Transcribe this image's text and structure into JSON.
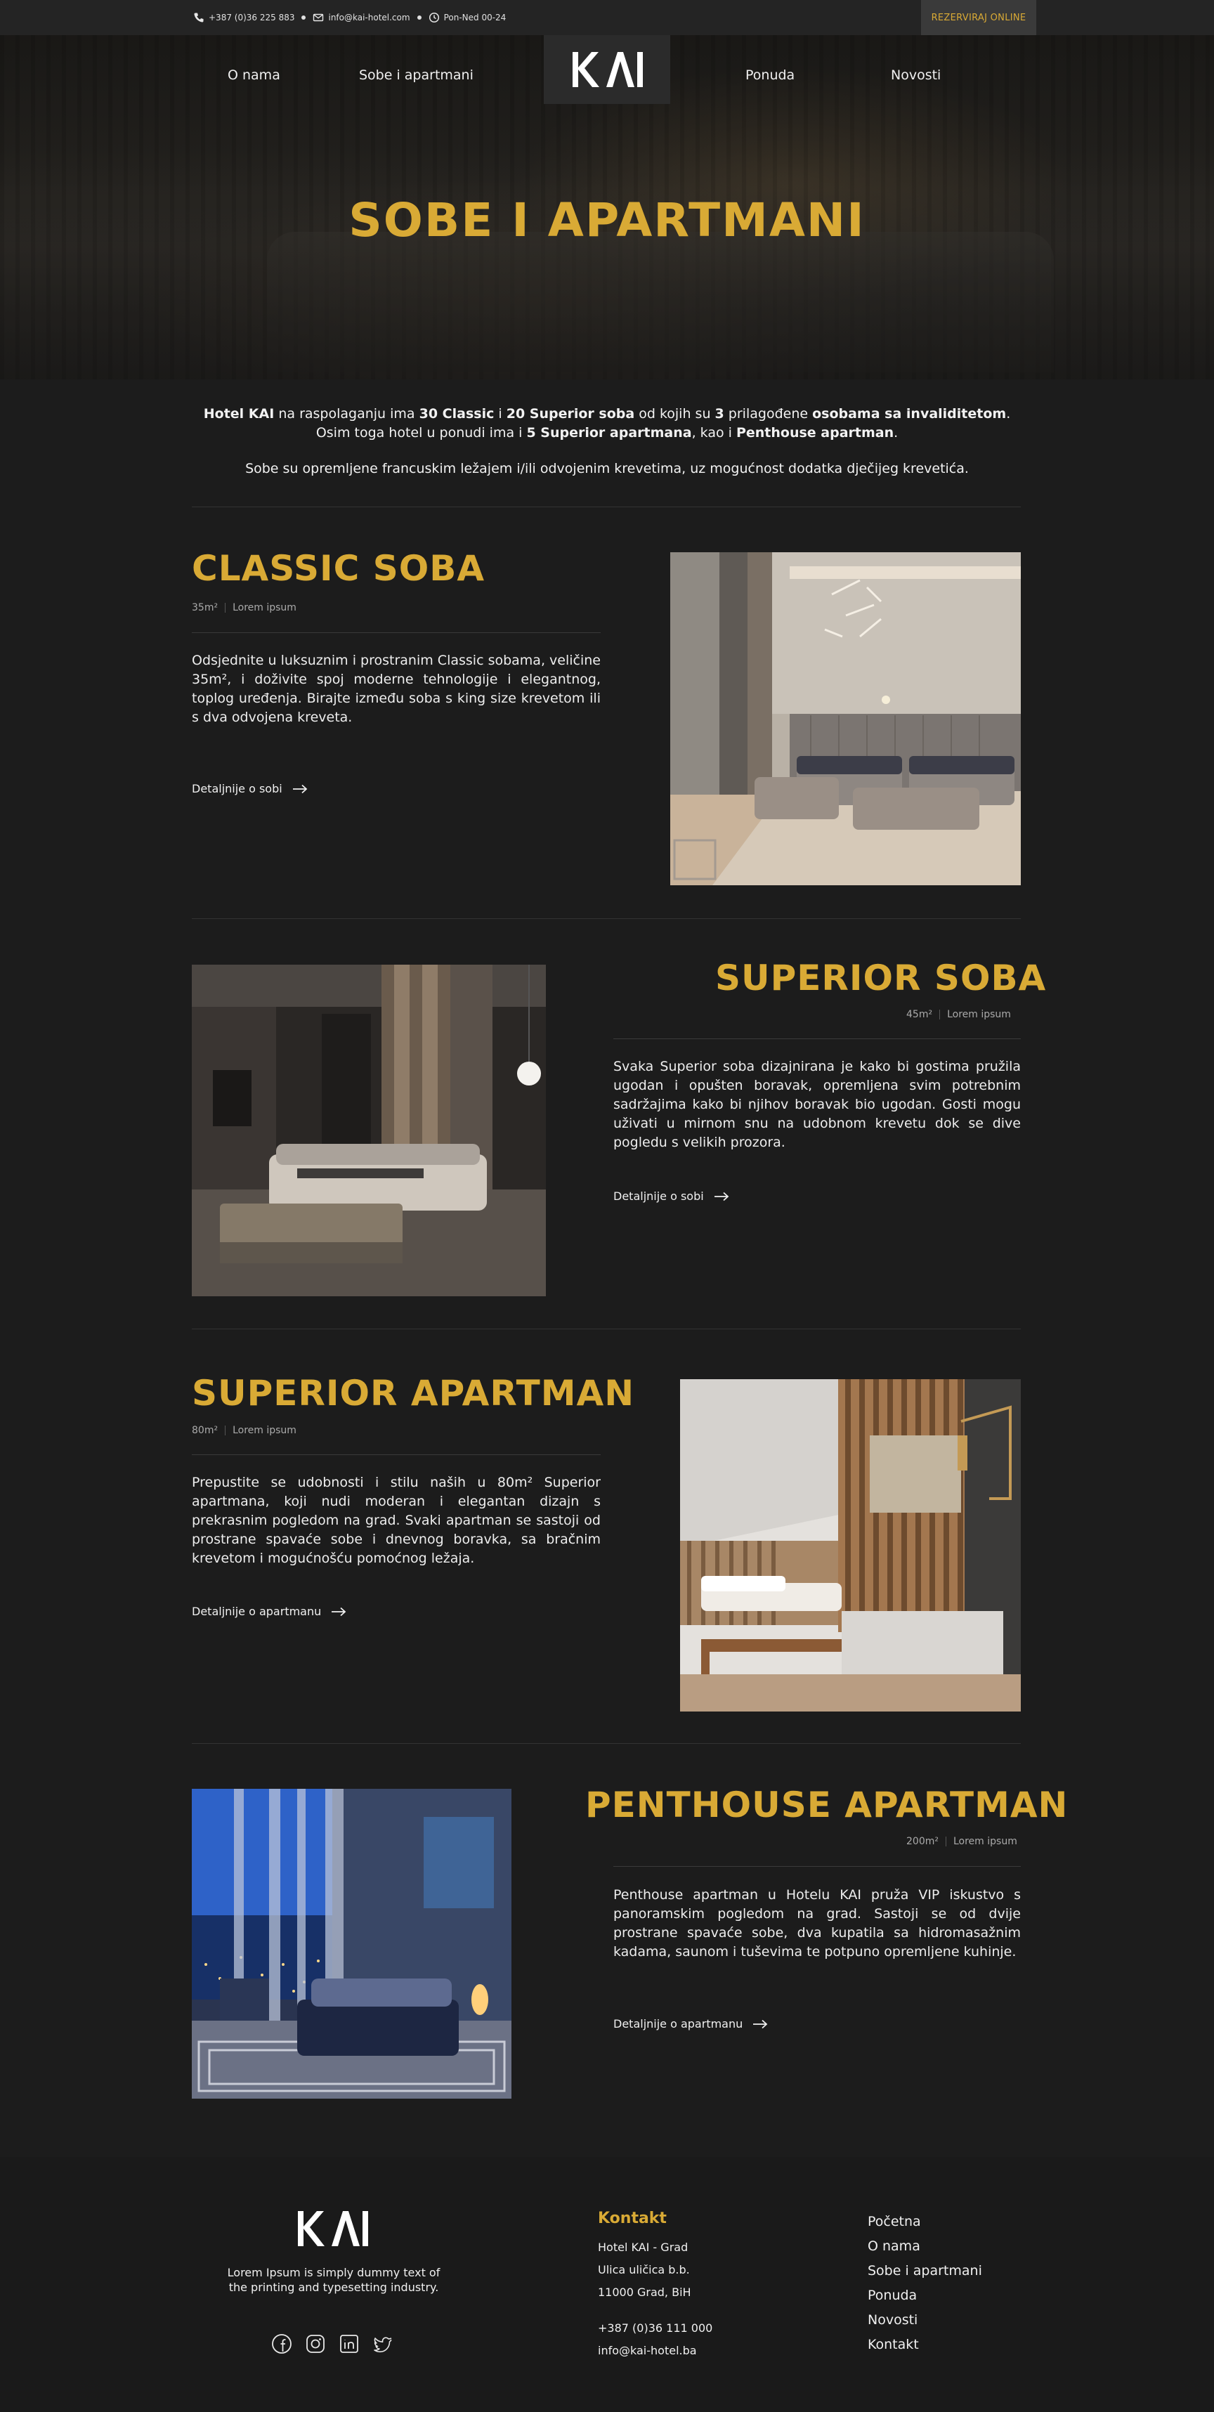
{
  "topbar": {
    "phone": "+387 (0)36 225 883",
    "email": "info@kai-hotel.com",
    "hours": "Pon-Ned 00-24",
    "reserve_label": "REZERVIRAJ ONLINE"
  },
  "brand": {
    "logo_text": "KAI"
  },
  "nav": {
    "about": "O nama",
    "rooms": "Sobe i apartmani",
    "offer": "Ponuda",
    "news": "Novosti",
    "active": "rooms"
  },
  "hero": {
    "title": "SOBE I APARTMANI"
  },
  "intro": {
    "l1_a": "Hotel KAI",
    "l1_b": " na raspolaganju ima ",
    "l1_c": "30 Classic",
    "l1_d": " i ",
    "l1_e": "20 Superior soba",
    "l1_f": " od kojih su ",
    "l1_g": "3",
    "l1_h": " prilagođene ",
    "l1_i": "osobama sa invaliditetom",
    "l1_j": ".",
    "l2_a": "Osim toga hotel u ponudi ima i ",
    "l2_b": "5 Superior apartmana",
    "l2_c": ", kao i ",
    "l2_d": "Penthouse apartman",
    "l2_e": ".",
    "p2": "Sobe su opremljene francuskim ležajem i/ili odvojenim krevetima, uz mogućnost dodatka dječijeg krevetića."
  },
  "rooms": [
    {
      "title": "CLASSIC SOBA",
      "size": "35m²",
      "tag": "Lorem ipsum",
      "description": "Odsjednite u luksuznim i prostranim Classic sobama, veličine 35m², i doživite spoj moderne tehnologije i elegantnog, toplog uređenja. Birajte između soba s king size krevetom ili s dva odvojena kreveta.",
      "link": "Detaljnije o sobi"
    },
    {
      "title": "SUPERIOR SOBA",
      "size": "45m²",
      "tag": "Lorem ipsum",
      "description": "Svaka Superior soba dizajnirana je kako bi gostima pružila ugodan i opušten boravak, opremljena svim potrebnim sadržajima kako bi njihov boravak bio ugodan. Gosti mogu uživati u mirnom snu na udobnom krevetu dok se dive pogledu s velikih prozora.",
      "link": "Detaljnije o sobi"
    },
    {
      "title": "SUPERIOR APARTMAN",
      "size": "80m²",
      "tag": "Lorem ipsum",
      "description": "Prepustite se udobnosti i stilu naših u 80m² Superior apartmana, koji nudi moderan i elegantan dizajn s prekrasnim pogledom na grad. Svaki apartman se sastoji od prostrane spavaće sobe i dnevnog boravka, sa bračnim krevetom i mogućnošću pomoćnog ležaja.",
      "link": "Detaljnije o apartmanu"
    },
    {
      "title": "PENTHOUSE APARTMAN",
      "size": "200m²",
      "tag": "Lorem ipsum",
      "description": "Penthouse apartman u Hotelu KAI pruža VIP iskustvo s panoramskim pogledom na grad. Sastoji se od dvije prostrane spavaće sobe, dva kupatila sa hidromasažnim kadama, saunom i tuševima te potpuno opremljene kuhinje.",
      "link": "Detaljnije o apartmanu"
    }
  ],
  "footer": {
    "tagline": "Lorem Ipsum is simply dummy text of the printing and typesetting industry.",
    "contact_heading": "Kontakt",
    "address_1": "Hotel KAI - Grad",
    "address_2": "Ulica uličica b.b.",
    "address_3": "11000 Grad, BiH",
    "phone": "+387 (0)36 111 000",
    "email": "info@kai-hotel.ba",
    "links": [
      "Početna",
      "O nama",
      "Sobe i apartmani",
      "Ponuda",
      "Novosti",
      "Kontakt"
    ]
  },
  "colors": {
    "accent": "#d9aa35",
    "background": "#1c1c1c",
    "footer": "#1a1a1a"
  }
}
